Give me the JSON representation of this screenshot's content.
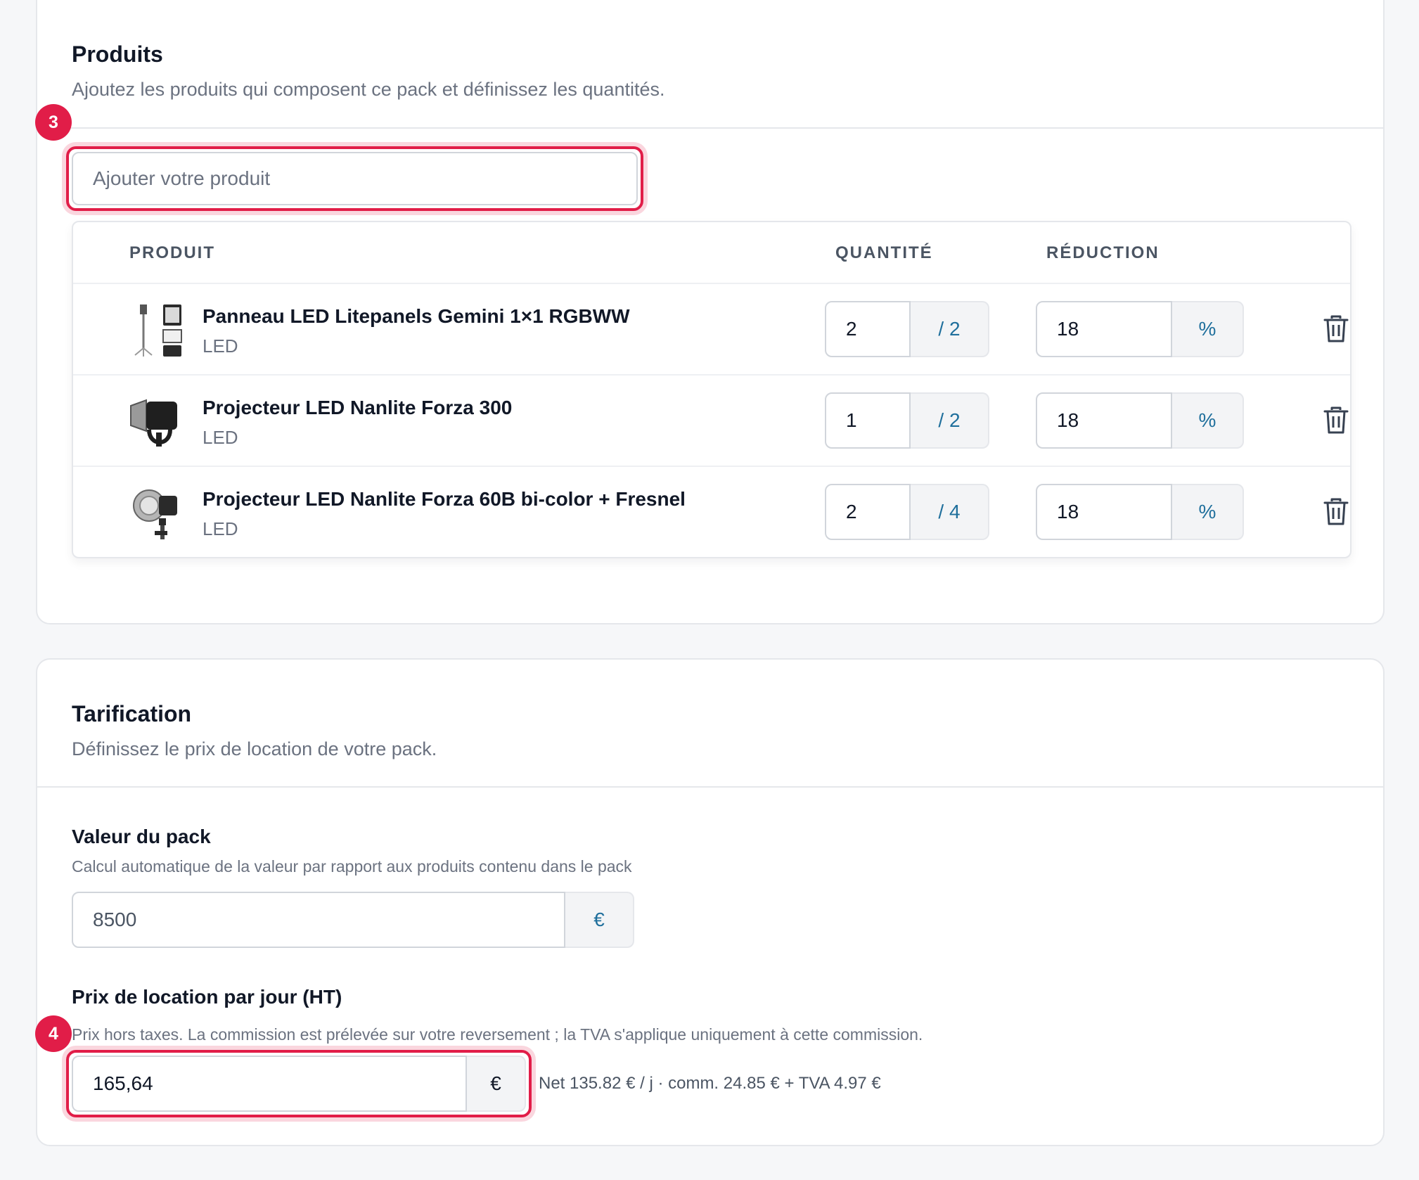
{
  "products_section": {
    "title": "Produits",
    "description": "Ajoutez les produits qui composent ce pack et définissez les quantités.",
    "step_badge": "3",
    "search_placeholder": "Ajouter votre produit",
    "columns": {
      "product": "PRODUIT",
      "quantity": "QUANTITÉ",
      "discount": "RÉDUCTION"
    },
    "rows": [
      {
        "name": "Panneau LED Litepanels Gemini 1×1 RGBWW",
        "category": "LED",
        "quantity": "2",
        "quantity_max": "/ 2",
        "discount": "18",
        "discount_unit": "%",
        "thumb_icon": "led-panel-icon"
      },
      {
        "name": "Projecteur LED Nanlite Forza 300",
        "category": "LED",
        "quantity": "1",
        "quantity_max": "/ 2",
        "discount": "18",
        "discount_unit": "%",
        "thumb_icon": "spotlight-icon"
      },
      {
        "name": "Projecteur LED Nanlite Forza 60B bi-color + Fresnel",
        "category": "LED",
        "quantity": "2",
        "quantity_max": "/ 4",
        "discount": "18",
        "discount_unit": "%",
        "thumb_icon": "fresnel-light-icon"
      }
    ]
  },
  "pricing_section": {
    "title": "Tarification",
    "description": "Définissez le prix de location de votre pack.",
    "step_badge": "4",
    "pack_value": {
      "label": "Valeur du pack",
      "help": "Calcul automatique de la valeur par rapport aux produits contenu dans le pack",
      "value": "8500",
      "currency": "€"
    },
    "daily_price": {
      "label": "Prix de location par jour (HT)",
      "help": "Prix hors taxes. La commission est prélevée sur votre reversement ; la TVA s'applique uniquement à cette commission.",
      "value": "165,64",
      "currency": "€",
      "net_note": "Net 135.82 € / j · comm. 24.85 € + TVA 4.97 €"
    }
  },
  "colors": {
    "accent": "#e11d48",
    "addon_text": "#1f6f9c",
    "border": "#d1d5db"
  }
}
